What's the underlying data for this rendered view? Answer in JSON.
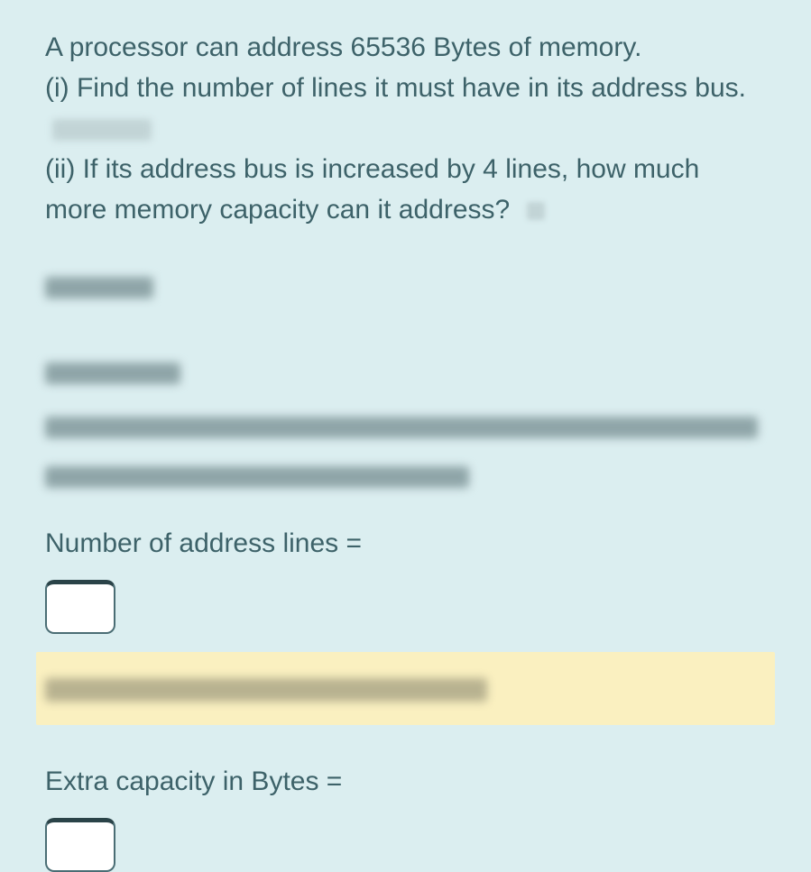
{
  "question": {
    "intro": "A processor can address 65536 Bytes of memory.",
    "part_i": "(i) Find the number of lines it must have in its address bus.",
    "part_ii": "(ii) If its address bus is increased by 4 lines, how much more memory capacity can it address?"
  },
  "prompts": {
    "address_lines": "Number of address lines =",
    "extra_capacity": "Extra capacity in Bytes ="
  },
  "inputs": {
    "address_lines_value": "",
    "extra_capacity_value": ""
  }
}
